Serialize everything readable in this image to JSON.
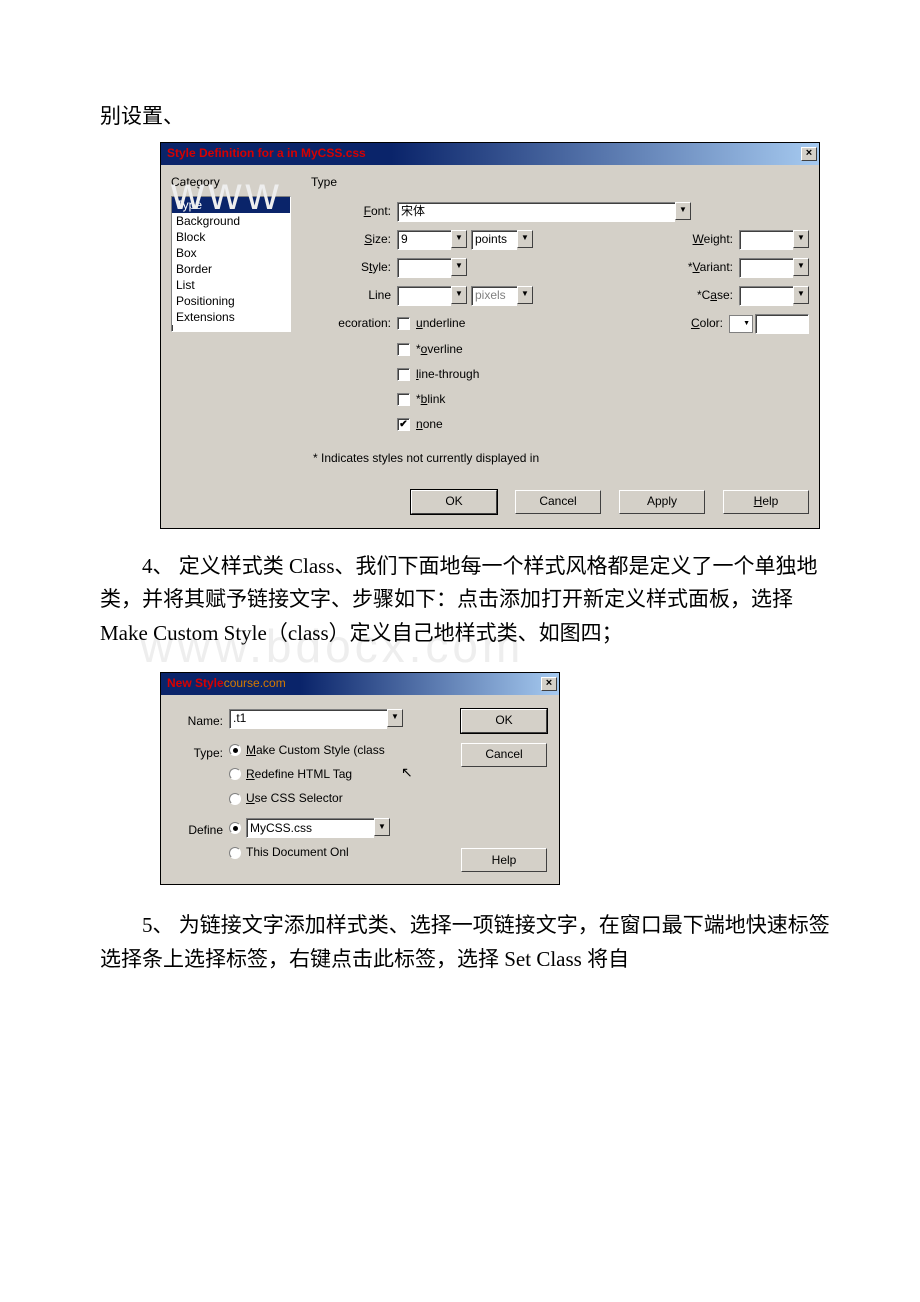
{
  "doc": {
    "line_top": "别设置、",
    "para4": "4、 定义样式类 Class、我们下面地每一个样式风格都是定义了一个单独地类，并将其赋予链接文字、步骤如下：点击添加打开新定义样式面板，选择 Make Custom Style（class）定义自己地样式类、如图四；",
    "para5": "5、 为链接文字添加样式类、选择一项链接文字，在窗口最下端地快速标签选择条上选择标签，右键点击此标签，选择 Set Class 将自",
    "watermark1": "www",
    "watermark2": "www.bdocx.com"
  },
  "dialog1": {
    "title": "Style Definition for a in MyCSS.css",
    "close": "×",
    "category_label": "Category",
    "categories": [
      "Type",
      "Background",
      "Block",
      "Box",
      "Border",
      "List",
      "Positioning",
      "Extensions"
    ],
    "type_label": "Type",
    "labels": {
      "font": "Font:",
      "size": "Size:",
      "style": "Style:",
      "line": "Line",
      "weight": "Weight:",
      "variant": "*Variant:",
      "case": "*Case:",
      "decoration": "ecoration:",
      "color": "Color:"
    },
    "values": {
      "font": "宋体",
      "size": "9",
      "size_unit": "points",
      "line_unit": "pixels"
    },
    "checks": {
      "underline": "underline",
      "overline": "*overline",
      "linethrough": "line-through",
      "blink": "*blink",
      "none": "none"
    },
    "note": "* Indicates styles not currently displayed in",
    "buttons": {
      "ok": "OK",
      "cancel": "Cancel",
      "apply": "Apply",
      "help": "Help"
    }
  },
  "dialog2": {
    "title": "New Style",
    "close": "×",
    "labels": {
      "name": "Name:",
      "type": "Type:",
      "define": "Define"
    },
    "name_value": ".t1",
    "type_opts": {
      "make": "Make Custom Style (class",
      "redef": "Redefine HTML Tag",
      "sel": "Use CSS Selector"
    },
    "define_value": "MyCSS.css",
    "define_opt2": "This Document Onl",
    "buttons": {
      "ok": "OK",
      "cancel": "Cancel",
      "help": "Help"
    }
  }
}
